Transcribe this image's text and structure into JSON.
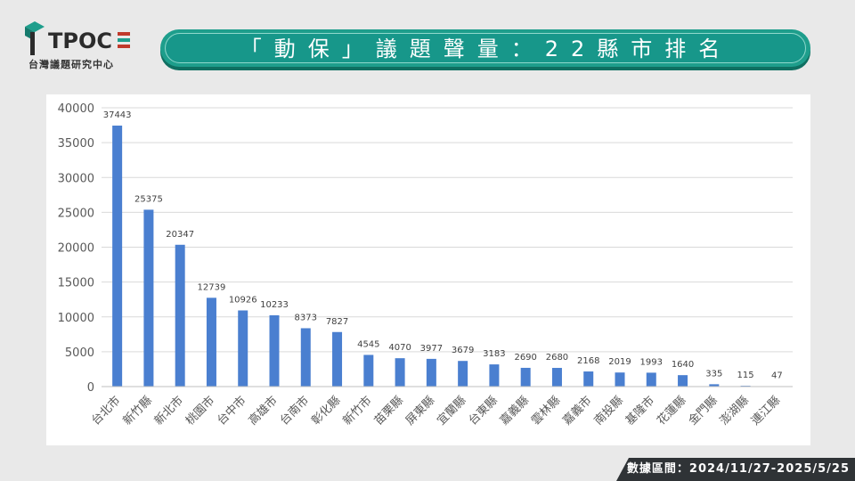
{
  "header": {
    "logo_text": "TPOC",
    "logo_subtitle": "台灣議題研究中心",
    "title": "「動保」議題聲量：22縣市排名"
  },
  "footer": {
    "date_range": "數據區間：2024/11/27-2025/5/25"
  },
  "colors": {
    "bar": "#4a7fd0",
    "title_bg": "#1e9e8c",
    "footer_bg": "#2f3336"
  },
  "chart_data": {
    "type": "bar",
    "categories": [
      "台北市",
      "新竹縣",
      "新北市",
      "桃園市",
      "台中市",
      "高雄市",
      "台南市",
      "彰化縣",
      "新竹市",
      "苗栗縣",
      "屏東縣",
      "宜蘭縣",
      "台東縣",
      "嘉義縣",
      "雲林縣",
      "嘉義市",
      "南投縣",
      "基隆市",
      "花蓮縣",
      "金門縣",
      "澎湖縣",
      "連江縣"
    ],
    "values": [
      37443,
      25375,
      20347,
      12739,
      10926,
      10233,
      8373,
      7827,
      4545,
      4070,
      3977,
      3679,
      3183,
      2690,
      2680,
      2168,
      2019,
      1993,
      1640,
      335,
      115,
      47
    ],
    "yticks": [
      0,
      5000,
      10000,
      15000,
      20000,
      25000,
      30000,
      35000,
      40000
    ],
    "ylim": [
      0,
      40000
    ],
    "grid": true,
    "data_labels": true
  }
}
